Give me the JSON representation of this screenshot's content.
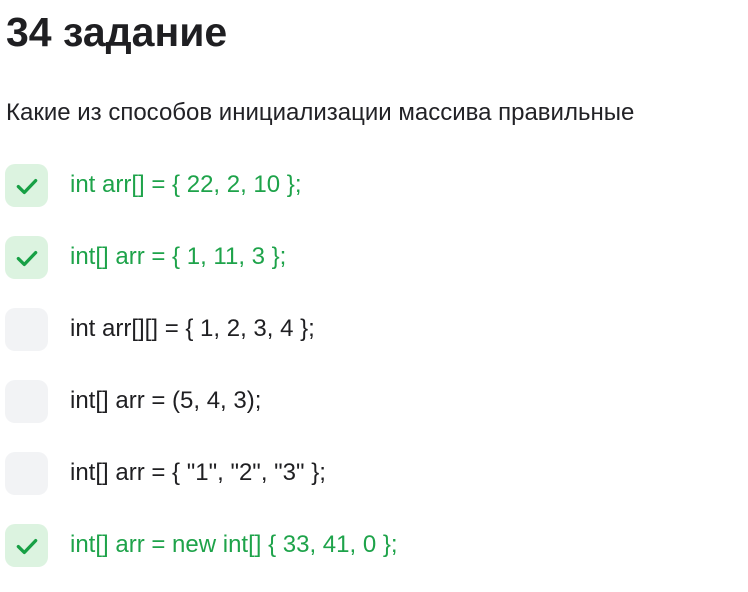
{
  "task": {
    "title": "34 задание",
    "question": "Какие из способов инициализации массива правильные"
  },
  "options": [
    {
      "text": "int arr[] = { 22, 2, 10 };",
      "checked": true
    },
    {
      "text": "int[] arr = { 1, 11, 3 };",
      "checked": true
    },
    {
      "text": "int arr[][] = { 1, 2, 3, 4 };",
      "checked": false
    },
    {
      "text": "int[] arr = (5, 4, 3);",
      "checked": false
    },
    {
      "text": "int[] arr = { \"1\", \"2\", \"3\" };",
      "checked": false
    },
    {
      "text": "int[] arr = new int[] { 33, 41, 0 };",
      "checked": true
    }
  ],
  "icons": {
    "checked": "check-icon"
  },
  "colors": {
    "correct_text": "#1ea34a",
    "checked_bg": "#dcf3e0",
    "unchecked_bg": "#f2f3f5",
    "check_mark": "#17a045"
  }
}
